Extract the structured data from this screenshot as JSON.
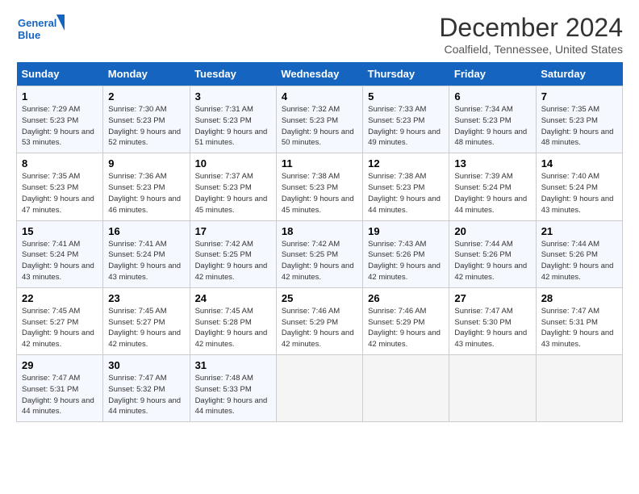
{
  "logo": {
    "line1": "General",
    "line2": "Blue"
  },
  "title": "December 2024",
  "location": "Coalfield, Tennessee, United States",
  "days_of_week": [
    "Sunday",
    "Monday",
    "Tuesday",
    "Wednesday",
    "Thursday",
    "Friday",
    "Saturday"
  ],
  "weeks": [
    [
      {
        "day": "1",
        "sunrise": "Sunrise: 7:29 AM",
        "sunset": "Sunset: 5:23 PM",
        "daylight": "Daylight: 9 hours and 53 minutes."
      },
      {
        "day": "2",
        "sunrise": "Sunrise: 7:30 AM",
        "sunset": "Sunset: 5:23 PM",
        "daylight": "Daylight: 9 hours and 52 minutes."
      },
      {
        "day": "3",
        "sunrise": "Sunrise: 7:31 AM",
        "sunset": "Sunset: 5:23 PM",
        "daylight": "Daylight: 9 hours and 51 minutes."
      },
      {
        "day": "4",
        "sunrise": "Sunrise: 7:32 AM",
        "sunset": "Sunset: 5:23 PM",
        "daylight": "Daylight: 9 hours and 50 minutes."
      },
      {
        "day": "5",
        "sunrise": "Sunrise: 7:33 AM",
        "sunset": "Sunset: 5:23 PM",
        "daylight": "Daylight: 9 hours and 49 minutes."
      },
      {
        "day": "6",
        "sunrise": "Sunrise: 7:34 AM",
        "sunset": "Sunset: 5:23 PM",
        "daylight": "Daylight: 9 hours and 48 minutes."
      },
      {
        "day": "7",
        "sunrise": "Sunrise: 7:35 AM",
        "sunset": "Sunset: 5:23 PM",
        "daylight": "Daylight: 9 hours and 48 minutes."
      }
    ],
    [
      {
        "day": "8",
        "sunrise": "Sunrise: 7:35 AM",
        "sunset": "Sunset: 5:23 PM",
        "daylight": "Daylight: 9 hours and 47 minutes."
      },
      {
        "day": "9",
        "sunrise": "Sunrise: 7:36 AM",
        "sunset": "Sunset: 5:23 PM",
        "daylight": "Daylight: 9 hours and 46 minutes."
      },
      {
        "day": "10",
        "sunrise": "Sunrise: 7:37 AM",
        "sunset": "Sunset: 5:23 PM",
        "daylight": "Daylight: 9 hours and 45 minutes."
      },
      {
        "day": "11",
        "sunrise": "Sunrise: 7:38 AM",
        "sunset": "Sunset: 5:23 PM",
        "daylight": "Daylight: 9 hours and 45 minutes."
      },
      {
        "day": "12",
        "sunrise": "Sunrise: 7:38 AM",
        "sunset": "Sunset: 5:23 PM",
        "daylight": "Daylight: 9 hours and 44 minutes."
      },
      {
        "day": "13",
        "sunrise": "Sunrise: 7:39 AM",
        "sunset": "Sunset: 5:24 PM",
        "daylight": "Daylight: 9 hours and 44 minutes."
      },
      {
        "day": "14",
        "sunrise": "Sunrise: 7:40 AM",
        "sunset": "Sunset: 5:24 PM",
        "daylight": "Daylight: 9 hours and 43 minutes."
      }
    ],
    [
      {
        "day": "15",
        "sunrise": "Sunrise: 7:41 AM",
        "sunset": "Sunset: 5:24 PM",
        "daylight": "Daylight: 9 hours and 43 minutes."
      },
      {
        "day": "16",
        "sunrise": "Sunrise: 7:41 AM",
        "sunset": "Sunset: 5:24 PM",
        "daylight": "Daylight: 9 hours and 43 minutes."
      },
      {
        "day": "17",
        "sunrise": "Sunrise: 7:42 AM",
        "sunset": "Sunset: 5:25 PM",
        "daylight": "Daylight: 9 hours and 42 minutes."
      },
      {
        "day": "18",
        "sunrise": "Sunrise: 7:42 AM",
        "sunset": "Sunset: 5:25 PM",
        "daylight": "Daylight: 9 hours and 42 minutes."
      },
      {
        "day": "19",
        "sunrise": "Sunrise: 7:43 AM",
        "sunset": "Sunset: 5:26 PM",
        "daylight": "Daylight: 9 hours and 42 minutes."
      },
      {
        "day": "20",
        "sunrise": "Sunrise: 7:44 AM",
        "sunset": "Sunset: 5:26 PM",
        "daylight": "Daylight: 9 hours and 42 minutes."
      },
      {
        "day": "21",
        "sunrise": "Sunrise: 7:44 AM",
        "sunset": "Sunset: 5:26 PM",
        "daylight": "Daylight: 9 hours and 42 minutes."
      }
    ],
    [
      {
        "day": "22",
        "sunrise": "Sunrise: 7:45 AM",
        "sunset": "Sunset: 5:27 PM",
        "daylight": "Daylight: 9 hours and 42 minutes."
      },
      {
        "day": "23",
        "sunrise": "Sunrise: 7:45 AM",
        "sunset": "Sunset: 5:27 PM",
        "daylight": "Daylight: 9 hours and 42 minutes."
      },
      {
        "day": "24",
        "sunrise": "Sunrise: 7:45 AM",
        "sunset": "Sunset: 5:28 PM",
        "daylight": "Daylight: 9 hours and 42 minutes."
      },
      {
        "day": "25",
        "sunrise": "Sunrise: 7:46 AM",
        "sunset": "Sunset: 5:29 PM",
        "daylight": "Daylight: 9 hours and 42 minutes."
      },
      {
        "day": "26",
        "sunrise": "Sunrise: 7:46 AM",
        "sunset": "Sunset: 5:29 PM",
        "daylight": "Daylight: 9 hours and 42 minutes."
      },
      {
        "day": "27",
        "sunrise": "Sunrise: 7:47 AM",
        "sunset": "Sunset: 5:30 PM",
        "daylight": "Daylight: 9 hours and 43 minutes."
      },
      {
        "day": "28",
        "sunrise": "Sunrise: 7:47 AM",
        "sunset": "Sunset: 5:31 PM",
        "daylight": "Daylight: 9 hours and 43 minutes."
      }
    ],
    [
      {
        "day": "29",
        "sunrise": "Sunrise: 7:47 AM",
        "sunset": "Sunset: 5:31 PM",
        "daylight": "Daylight: 9 hours and 44 minutes."
      },
      {
        "day": "30",
        "sunrise": "Sunrise: 7:47 AM",
        "sunset": "Sunset: 5:32 PM",
        "daylight": "Daylight: 9 hours and 44 minutes."
      },
      {
        "day": "31",
        "sunrise": "Sunrise: 7:48 AM",
        "sunset": "Sunset: 5:33 PM",
        "daylight": "Daylight: 9 hours and 44 minutes."
      },
      null,
      null,
      null,
      null
    ]
  ]
}
